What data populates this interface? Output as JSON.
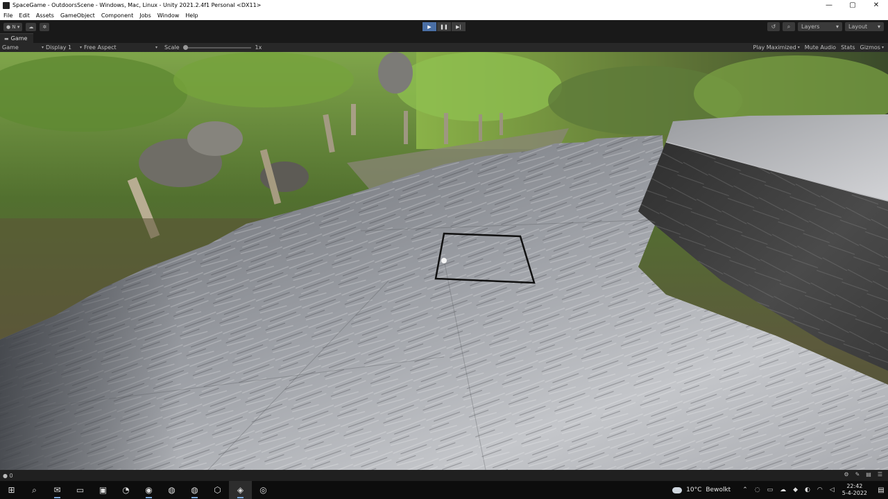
{
  "window": {
    "title": "SpaceGame - OutdoorsScene - Windows, Mac, Linux - Unity 2021.2.4f1 Personal <DX11>",
    "controls": [
      "—",
      "▢",
      "✕"
    ]
  },
  "menu": [
    "File",
    "Edit",
    "Assets",
    "GameObject",
    "Component",
    "Jobs",
    "Window",
    "Help"
  ],
  "toolbar": {
    "account_label": "N",
    "layers_label": "Layers",
    "layout_label": "Layout"
  },
  "tab": {
    "label": "Game"
  },
  "gamebar": {
    "mode": "Game",
    "display": "Display 1",
    "aspect": "Free Aspect",
    "scale_label": "Scale",
    "scale_value": "1x",
    "scale_fraction": 0.0,
    "play_maximized": "Play Maximized",
    "mute_audio": "Mute Audio",
    "stats": "Stats",
    "gizmos": "Gizmos"
  },
  "status": {
    "left_count": "0"
  },
  "taskbar": {
    "apps": [
      "windows-start",
      "search",
      "mail",
      "file-explorer",
      "store",
      "blender",
      "discord",
      "chrome",
      "chrome-profile",
      "unity-hub",
      "unity-editor",
      "obs"
    ],
    "active_app": "unity-editor",
    "weather_temp": "10°C",
    "weather_text": "Bewolkt",
    "time": "22:42",
    "date": "5-4-2022"
  },
  "colors": {
    "play_active": "#4a6fa5",
    "editor_bg": "#191919",
    "panel_bg": "#282828",
    "taskbar_bg": "#0d0d0d"
  }
}
